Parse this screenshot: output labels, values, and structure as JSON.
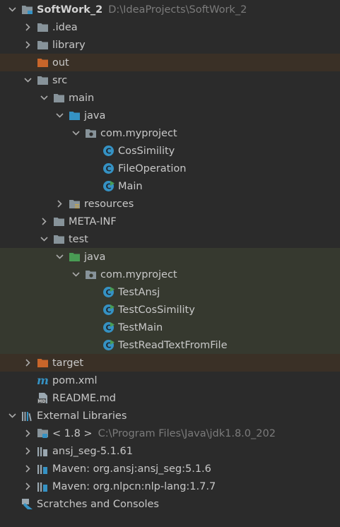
{
  "tree": {
    "project": {
      "name": "SoftWork_2",
      "path": "D:\\IdeaProjects\\SoftWork_2"
    },
    "idea": ".idea",
    "library": "library",
    "out": "out",
    "src": "src",
    "main": "main",
    "main_java": "java",
    "main_pkg": "com.myproject",
    "main_classes": [
      "CosSimility",
      "FileOperation",
      "Main"
    ],
    "resources": "resources",
    "meta_inf": "META-INF",
    "test": "test",
    "test_java": "java",
    "test_pkg": "com.myproject",
    "test_classes": [
      "TestAnsj",
      "TestCosSimility",
      "TestMain",
      "TestReadTextFromFile"
    ],
    "target": "target",
    "pom": "pom.xml",
    "readme": "README.md",
    "external_libraries": "External Libraries",
    "jdk": {
      "name": "< 1.8 >",
      "path": "C:\\Program Files\\Java\\jdk1.8.0_202"
    },
    "libs": [
      "ansj_seg-5.1.61",
      "Maven: org.ansj:ansj_seg:5.1.6",
      "Maven: org.nlpcn:nlp-lang:1.7.7"
    ],
    "scratches": "Scratches and Consoles"
  },
  "colors": {
    "background": "#2b2b2b",
    "excluded_row": "#3a3026",
    "test_row": "#36392f",
    "folder": "#87939a",
    "source_folder": "#3592c4",
    "test_folder": "#499c54",
    "excluded_folder": "#c8652a",
    "class_icon": "#3592c4",
    "runnable_badge": "#499c54",
    "hint_text": "#7b7b7b"
  },
  "icons": {
    "collapsed": "chevron-right-icon",
    "expanded": "chevron-down-icon",
    "folder": "folder-icon",
    "package": "package-icon",
    "class": "class-icon",
    "maven": "maven-icon",
    "markdown": "markdown-icon",
    "library": "library-icon",
    "scratches": "scratches-icon"
  }
}
